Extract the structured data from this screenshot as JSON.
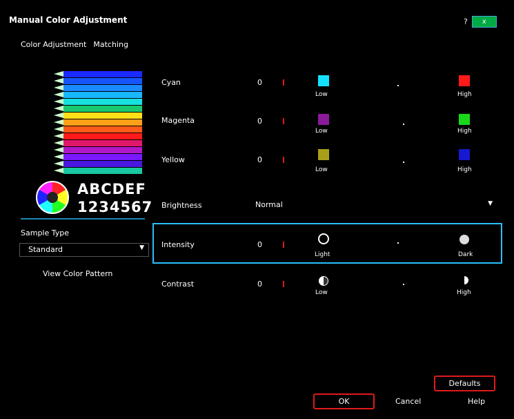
{
  "window": {
    "title": "Manual Color Adjustment",
    "help_label": "?",
    "close_label": "x"
  },
  "tabs": [
    {
      "label": "Color Adjustment"
    },
    {
      "label": "Matching"
    }
  ],
  "sample": {
    "text_line1": "ABCDEF",
    "text_line2": "1234567",
    "type_label": "Sample Type",
    "type_value": "Standard",
    "view_pattern_label": "View Color Pattern"
  },
  "rows": {
    "cyan": {
      "label": "Cyan",
      "value": "0",
      "low": "Low",
      "high": "High",
      "low_color": "#16e0ff",
      "high_color": "#ff1a1a"
    },
    "magenta": {
      "label": "Magenta",
      "value": "0",
      "low": "Low",
      "high": "High",
      "low_color": "#8a1a9a",
      "high_color": "#18d818"
    },
    "yellow": {
      "label": "Yellow",
      "value": "0",
      "low": "Low",
      "high": "High",
      "low_color": "#a8a018",
      "high_color": "#1818d0"
    },
    "brightness": {
      "label": "Brightness",
      "value": "Normal"
    },
    "intensity": {
      "label": "Intensity",
      "value": "0",
      "low": "Light",
      "high": "Dark"
    },
    "contrast": {
      "label": "Contrast",
      "value": "0",
      "low": "Low",
      "high": "High"
    }
  },
  "buttons": {
    "defaults": "Defaults",
    "ok": "OK",
    "cancel": "Cancel",
    "help": "Help"
  },
  "colors": {
    "accent_red": "#e01a1a",
    "focus_blue": "#29c0ff"
  }
}
